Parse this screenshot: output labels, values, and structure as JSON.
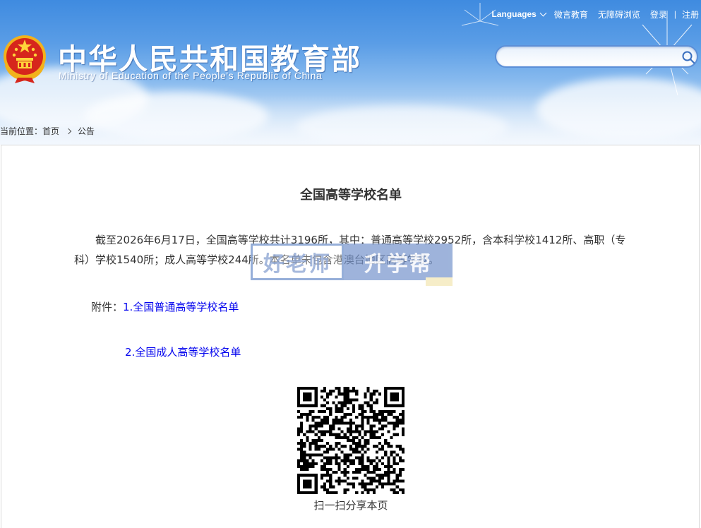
{
  "header": {
    "title_cn": "中华人民共和国教育部",
    "title_en": "Ministry of Education of the People's Republic of China",
    "top_links": {
      "languages": "Languages",
      "weibo": "微言教育",
      "accessibility": "无障碍浏览",
      "login": "登录",
      "separator": "|",
      "register": "注册"
    },
    "search": {
      "placeholder": "",
      "value": ""
    }
  },
  "breadcrumb": {
    "label": "当前位置：",
    "items": [
      "首页",
      "公告"
    ]
  },
  "article": {
    "title": "全国高等学校名单",
    "body": "截至2026年6月17日，全国高等学校共计3196所，其中：普通高等学校2952所，含本科学校1412所、高职（专科）学校1540所；成人高等学校244所。本名单未包含港澳台地区高等学校。",
    "attachment_label": "附件：",
    "attachments": [
      {
        "number": "1.",
        "text": "全国普通高等学校名单"
      },
      {
        "number": "2.",
        "text": "全国成人高等学校名单"
      }
    ]
  },
  "watermark": {
    "left": "好老师",
    "right": "升学帮"
  },
  "share": {
    "caption": "扫一扫分享本页"
  },
  "colors": {
    "banner_top": "#3f8be0",
    "link": "#0000ee",
    "text": "#333333"
  }
}
